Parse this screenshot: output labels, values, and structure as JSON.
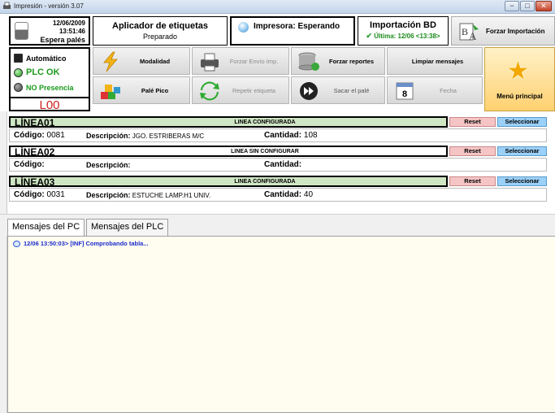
{
  "window": {
    "title": "Impresión - versión 3.07",
    "buttons": [
      "−",
      "□",
      "✕"
    ]
  },
  "clock": {
    "date": "12/06/2009",
    "time": "13:51:46",
    "status": "Espera palés"
  },
  "aplicador": {
    "title": "Aplicador de etiquetas",
    "status": "Preparado"
  },
  "impresora": {
    "label": "Impresora: Esperando"
  },
  "importacion": {
    "title": "Importación BD",
    "last": "Última: 12/06 <13:38>"
  },
  "forzar_importacion": {
    "label": "Forzar Importación"
  },
  "status": {
    "automatico": "Automático",
    "plc": "PLC OK",
    "presencia": "NO Presencia",
    "code": "L00"
  },
  "toolbar": {
    "modalidad": "Modalidad",
    "forzar_envio": "Forzar Envío Imp.",
    "forzar_reportes": "Forzar reportes",
    "limpiar_mensajes": "Limpiar mensajes",
    "pale_pico": "Palé Pico",
    "repetir_etiqueta": "Repetir etiqueta",
    "sacar_pale": "Sacar el palé",
    "fecha": "Fecha",
    "fecha_day": "8",
    "menu_principal": "Menú principal"
  },
  "lines": [
    {
      "name": "LÍNEA01",
      "state": "LINEA CONFIGURADA",
      "codigo_label": "Código:",
      "codigo": "0081",
      "desc_label": "Descripción:",
      "descripcion": "JGO. ESTRIBERAS M/C",
      "cant_label": "Cantidad:",
      "cantidad": "108",
      "reset": "Reset",
      "select": "Seleccionar"
    },
    {
      "name": "LÍNEA02",
      "state": "LINEA SIN CONFIGURAR",
      "codigo_label": "Código:",
      "codigo": "",
      "desc_label": "Descripción:",
      "descripcion": "",
      "cant_label": "Cantidad:",
      "cantidad": "",
      "reset": "Reset",
      "select": "Seleccionar"
    },
    {
      "name": "LÍNEA03",
      "state": "LINEA CONFIGURADA",
      "codigo_label": "Código:",
      "codigo": "0031",
      "desc_label": "Descripción:",
      "descripcion": "ESTUCHE LAMP.H1 UNIV.",
      "cant_label": "Cantidad:",
      "cantidad": "40",
      "reset": "Reset",
      "select": "Seleccionar"
    }
  ],
  "tabs": {
    "pc": "Mensajes del PC",
    "plc": "Mensajes del PLC"
  },
  "messages": [
    "12/06 13:50:03> [INF] Comprobando tabla..."
  ],
  "colors": {
    "line_configured": "#cfe6c4",
    "reset": "#f5c5c5",
    "select": "#9bd0f8",
    "plc_ok": "#1a9a1a",
    "code": "#d02020"
  }
}
